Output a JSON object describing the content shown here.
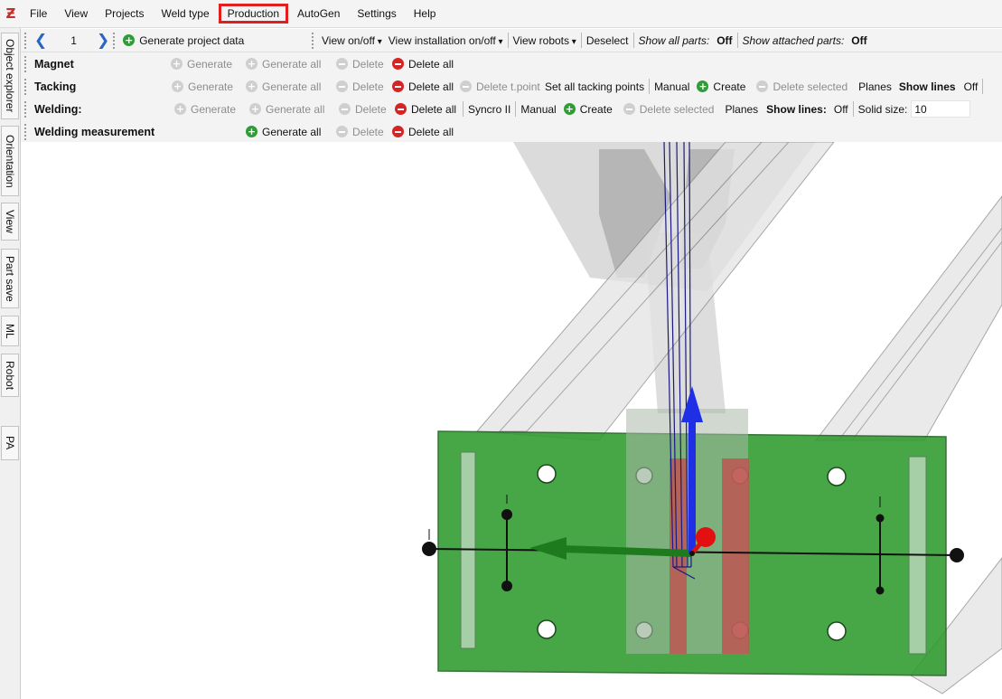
{
  "app": {
    "logo": "Ƶ"
  },
  "menu": {
    "file": "File",
    "view": "View",
    "projects": "Projects",
    "weld_type": "Weld type",
    "production": "Production",
    "autogen": "AutoGen",
    "settings": "Settings",
    "help": "Help"
  },
  "side_tabs": [
    "Object explorer",
    "Orientation",
    "View",
    "Part save",
    "ML",
    "Robot",
    "PA"
  ],
  "toolbar": {
    "page_number": "1",
    "generate_project_data": "Generate project data",
    "view_onoff": "View on/off",
    "view_installation_onoff": "View installation on/off",
    "view_robots": "View robots",
    "deselect": "Deselect",
    "show_all_parts_label": "Show all parts:",
    "show_all_parts_value": "Off",
    "show_attached_parts_label": "Show attached parts:",
    "show_attached_parts_value": "Off"
  },
  "magnet": {
    "label": "Magnet",
    "generate": "Generate",
    "generate_all": "Generate all",
    "delete": "Delete",
    "delete_all": "Delete all"
  },
  "tacking": {
    "label": "Tacking",
    "generate": "Generate",
    "generate_all": "Generate all",
    "delete": "Delete",
    "delete_all": "Delete all",
    "delete_tpoint": "Delete t.point",
    "set_all_tacking_points": "Set all tacking points",
    "manual": "Manual",
    "create": "Create",
    "delete_selected": "Delete selected",
    "planes": "Planes",
    "show_lines_label": "Show lines",
    "show_lines_value": "Off"
  },
  "welding": {
    "label": "Welding:",
    "generate": "Generate",
    "generate_all": "Generate all",
    "delete": "Delete",
    "delete_all": "Delete all",
    "syncro": "Syncro II",
    "manual": "Manual",
    "create": "Create",
    "delete_selected": "Delete selected",
    "planes": "Planes",
    "show_lines_label": "Show lines:",
    "show_lines_value": "Off",
    "solid_size_label": "Solid size:",
    "solid_size_value": "10"
  },
  "welding_measurement": {
    "label": "Welding measurement",
    "generate_all": "Generate all",
    "delete": "Delete",
    "delete_all": "Delete all"
  },
  "colors": {
    "highlight": "#e0201f",
    "plate_green": "#2e9b2e",
    "axis_blue": "#1f2fe6",
    "axis_red": "#e21010",
    "axis_green": "#1d7a1d",
    "tack_red": "#c0504d"
  }
}
